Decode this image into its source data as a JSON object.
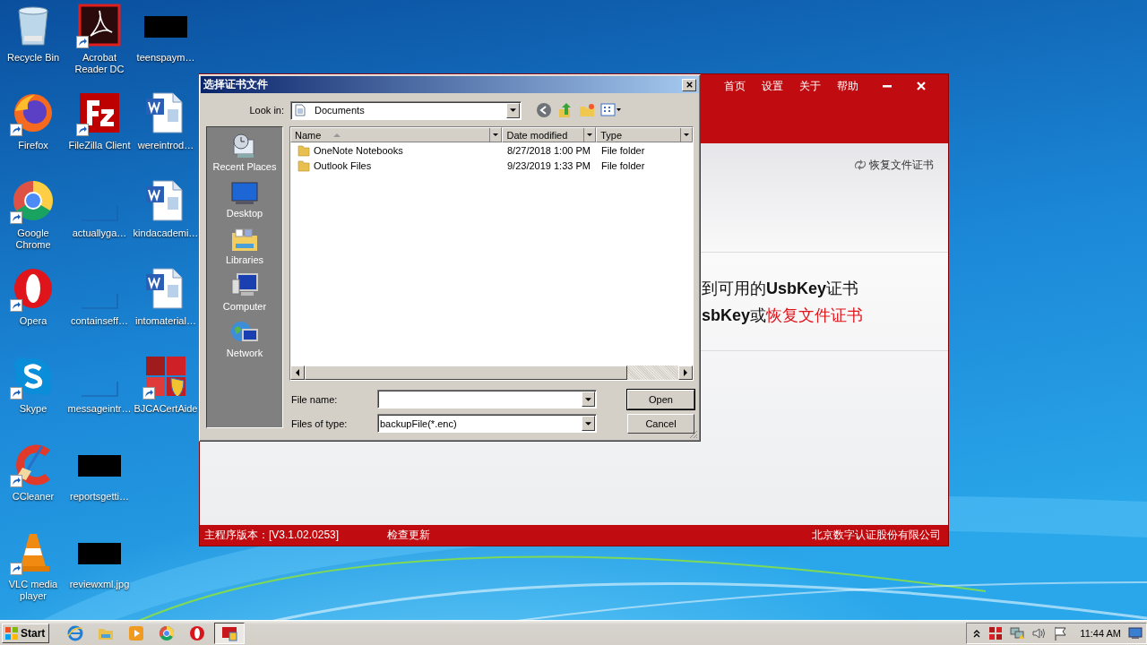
{
  "desktop": {
    "columns": [
      [
        {
          "label": "Recycle Bin",
          "kind": "recycle",
          "shortcut": false
        },
        {
          "label": "Firefox",
          "kind": "firefox",
          "shortcut": true
        },
        {
          "label": "Google Chrome",
          "kind": "chrome",
          "shortcut": true
        },
        {
          "label": "Opera",
          "kind": "opera",
          "shortcut": true
        },
        {
          "label": "Skype",
          "kind": "skype",
          "shortcut": true
        },
        {
          "label": "CCleaner",
          "kind": "ccleaner",
          "shortcut": true
        },
        {
          "label": "VLC media player",
          "kind": "vlc",
          "shortcut": true
        }
      ],
      [
        {
          "label": "Acrobat Reader DC",
          "kind": "acrobat",
          "shortcut": true
        },
        {
          "label": "FileZilla Client",
          "kind": "filezilla",
          "shortcut": true
        },
        {
          "label": "actuallyga…",
          "kind": "blank",
          "shortcut": false
        },
        {
          "label": "containseff…",
          "kind": "blank",
          "shortcut": false
        },
        {
          "label": "messageintr…",
          "kind": "blank",
          "shortcut": false
        },
        {
          "label": "reportsgetti…",
          "kind": "redacted",
          "shortcut": false
        },
        {
          "label": "reviewxml.jpg",
          "kind": "redacted",
          "shortcut": false
        }
      ],
      [
        {
          "label": "teenspaym…",
          "kind": "redacted",
          "shortcut": false
        },
        {
          "label": "wereintrod…",
          "kind": "word",
          "shortcut": false
        },
        {
          "label": "kindacademi…",
          "kind": "word",
          "shortcut": false
        },
        {
          "label": "intomaterial…",
          "kind": "word",
          "shortcut": false
        },
        {
          "label": "BJCACertAide",
          "kind": "bjca",
          "shortcut": true
        }
      ]
    ]
  },
  "app_window": {
    "nav": [
      "首页",
      "设置",
      "关于",
      "帮助"
    ],
    "restore_link": "恢复文件证书",
    "message_lines": [
      {
        "text": "到可用的**UsbKey**证书"
      },
      {
        "text": "**sbKey**或",
        "link": "恢复文件证书"
      }
    ],
    "footer": {
      "version": "主程序版本：[V3.1.02.0253]",
      "check_update": "检查更新",
      "company": "北京数字认证股份有限公司"
    }
  },
  "dialog": {
    "title": "选择证书文件",
    "look_in_label": "Look in:",
    "look_in": "Documents",
    "places": [
      {
        "label": "Recent Places",
        "kind": "recent"
      },
      {
        "label": "Desktop",
        "kind": "desktop"
      },
      {
        "label": "Libraries",
        "kind": "libraries"
      },
      {
        "label": "Computer",
        "kind": "computer"
      },
      {
        "label": "Network",
        "kind": "network"
      }
    ],
    "columns": [
      {
        "label": "Name",
        "sorted": true
      },
      {
        "label": "Date modified",
        "sorted": false
      },
      {
        "label": "Type",
        "sorted": false
      }
    ],
    "files": [
      {
        "name": "OneNote Notebooks",
        "date": "8/27/2018 1:00 PM",
        "type": "File folder"
      },
      {
        "name": "Outlook Files",
        "date": "9/23/2019 1:33 PM",
        "type": "File folder"
      }
    ],
    "file_name_label": "File name:",
    "file_type_label": "Files of type:",
    "file_type": "backupFile(*.enc)",
    "buttons": [
      {
        "label": "Open",
        "default": true
      },
      {
        "label": "Cancel",
        "default": false
      }
    ]
  },
  "taskbar": {
    "start": "Start",
    "apps": [
      {
        "kind": "ie",
        "active": false
      },
      {
        "kind": "explorer",
        "active": false
      },
      {
        "kind": "media",
        "active": false
      },
      {
        "kind": "chrome",
        "active": false
      },
      {
        "kind": "opera",
        "active": false
      },
      {
        "kind": "app",
        "active": true
      }
    ],
    "tray": [
      {
        "kind": "chevron"
      },
      {
        "kind": "app"
      },
      {
        "kind": "network"
      },
      {
        "kind": "speaker"
      },
      {
        "kind": "flag"
      }
    ],
    "clock": "11:44 AM"
  }
}
